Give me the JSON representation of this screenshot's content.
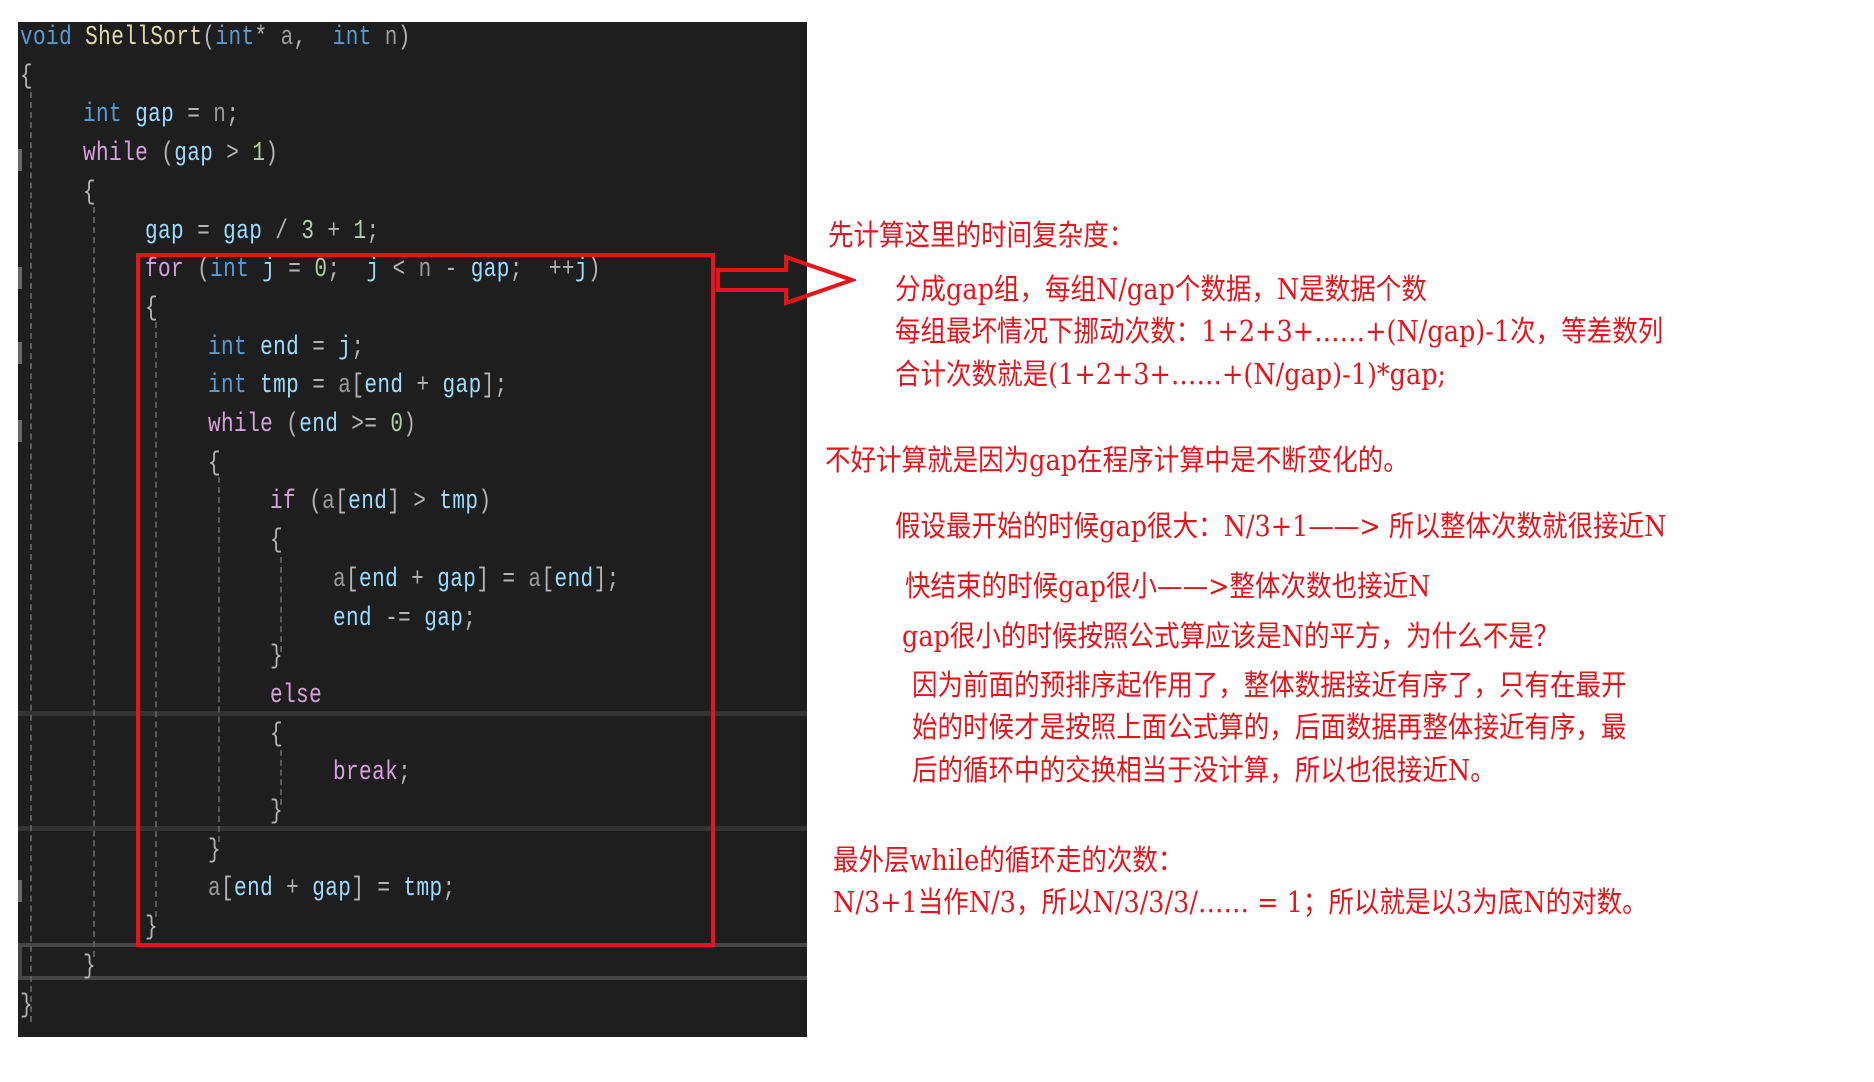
{
  "code": {
    "lines": [
      [
        {
          "t": "void",
          "c": "kw"
        },
        {
          "t": " ",
          "c": "op"
        },
        {
          "t": "ShellSort",
          "c": "fn"
        },
        {
          "t": "(",
          "c": "op"
        },
        {
          "t": "int",
          "c": "kw"
        },
        {
          "t": "* ",
          "c": "op"
        },
        {
          "t": "a",
          "c": "par"
        },
        {
          "t": ",  ",
          "c": "op"
        },
        {
          "t": "int",
          "c": "kw"
        },
        {
          "t": " ",
          "c": "op"
        },
        {
          "t": "n",
          "c": "par"
        },
        {
          "t": ")",
          "c": "op"
        }
      ],
      [
        {
          "t": "{",
          "c": "op"
        }
      ],
      [
        {
          "t": "int",
          "c": "kw"
        },
        {
          "t": " ",
          "c": "op"
        },
        {
          "t": "gap",
          "c": "var"
        },
        {
          "t": " = ",
          "c": "op"
        },
        {
          "t": "n",
          "c": "par"
        },
        {
          "t": ";",
          "c": "op"
        }
      ],
      [
        {
          "t": "while",
          "c": "ctl"
        },
        {
          "t": " (",
          "c": "op"
        },
        {
          "t": "gap",
          "c": "var"
        },
        {
          "t": " > ",
          "c": "op"
        },
        {
          "t": "1",
          "c": "num"
        },
        {
          "t": ")",
          "c": "op"
        }
      ],
      [
        {
          "t": "{",
          "c": "op"
        }
      ],
      [
        {
          "t": "gap",
          "c": "var"
        },
        {
          "t": " = ",
          "c": "op"
        },
        {
          "t": "gap",
          "c": "var"
        },
        {
          "t": " / ",
          "c": "op"
        },
        {
          "t": "3",
          "c": "num"
        },
        {
          "t": " + ",
          "c": "op"
        },
        {
          "t": "1",
          "c": "num"
        },
        {
          "t": ";",
          "c": "op"
        }
      ],
      [
        {
          "t": "for",
          "c": "ctl"
        },
        {
          "t": " (",
          "c": "op"
        },
        {
          "t": "int",
          "c": "kw"
        },
        {
          "t": " ",
          "c": "op"
        },
        {
          "t": "j",
          "c": "var"
        },
        {
          "t": " = ",
          "c": "op"
        },
        {
          "t": "0",
          "c": "num"
        },
        {
          "t": ";  ",
          "c": "op"
        },
        {
          "t": "j",
          "c": "var"
        },
        {
          "t": " < ",
          "c": "op"
        },
        {
          "t": "n",
          "c": "par"
        },
        {
          "t": " - ",
          "c": "op"
        },
        {
          "t": "gap",
          "c": "var"
        },
        {
          "t": ";  ++",
          "c": "op"
        },
        {
          "t": "j",
          "c": "var"
        },
        {
          "t": ")",
          "c": "op"
        }
      ],
      [
        {
          "t": "{",
          "c": "op"
        }
      ],
      [
        {
          "t": "int",
          "c": "kw"
        },
        {
          "t": " ",
          "c": "op"
        },
        {
          "t": "end",
          "c": "var"
        },
        {
          "t": " = ",
          "c": "op"
        },
        {
          "t": "j",
          "c": "var"
        },
        {
          "t": ";",
          "c": "op"
        }
      ],
      [
        {
          "t": "int",
          "c": "kw"
        },
        {
          "t": " ",
          "c": "op"
        },
        {
          "t": "tmp",
          "c": "var"
        },
        {
          "t": " = ",
          "c": "op"
        },
        {
          "t": "a",
          "c": "par"
        },
        {
          "t": "[",
          "c": "op"
        },
        {
          "t": "end",
          "c": "var"
        },
        {
          "t": " + ",
          "c": "op"
        },
        {
          "t": "gap",
          "c": "var"
        },
        {
          "t": "];",
          "c": "op"
        }
      ],
      [
        {
          "t": "while",
          "c": "ctl"
        },
        {
          "t": " (",
          "c": "op"
        },
        {
          "t": "end",
          "c": "var"
        },
        {
          "t": " >= ",
          "c": "op"
        },
        {
          "t": "0",
          "c": "num"
        },
        {
          "t": ")",
          "c": "op"
        }
      ],
      [
        {
          "t": "{",
          "c": "op"
        }
      ],
      [
        {
          "t": "if",
          "c": "ctl"
        },
        {
          "t": " (",
          "c": "op"
        },
        {
          "t": "a",
          "c": "par"
        },
        {
          "t": "[",
          "c": "op"
        },
        {
          "t": "end",
          "c": "var"
        },
        {
          "t": "] > ",
          "c": "op"
        },
        {
          "t": "tmp",
          "c": "var"
        },
        {
          "t": ")",
          "c": "op"
        }
      ],
      [
        {
          "t": "{",
          "c": "op"
        }
      ],
      [
        {
          "t": "a",
          "c": "par"
        },
        {
          "t": "[",
          "c": "op"
        },
        {
          "t": "end",
          "c": "var"
        },
        {
          "t": " + ",
          "c": "op"
        },
        {
          "t": "gap",
          "c": "var"
        },
        {
          "t": "] = ",
          "c": "op"
        },
        {
          "t": "a",
          "c": "par"
        },
        {
          "t": "[",
          "c": "op"
        },
        {
          "t": "end",
          "c": "var"
        },
        {
          "t": "];",
          "c": "op"
        }
      ],
      [
        {
          "t": "end",
          "c": "var"
        },
        {
          "t": " -= ",
          "c": "op"
        },
        {
          "t": "gap",
          "c": "var"
        },
        {
          "t": ";",
          "c": "op"
        }
      ],
      [
        {
          "t": "}",
          "c": "op"
        }
      ],
      [
        {
          "t": "else",
          "c": "ctl"
        }
      ],
      [
        {
          "t": "{",
          "c": "op"
        }
      ],
      [
        {
          "t": "break",
          "c": "ctl"
        },
        {
          "t": ";",
          "c": "op"
        }
      ],
      [
        {
          "t": "}",
          "c": "op"
        }
      ],
      [
        {
          "t": "}",
          "c": "op"
        }
      ],
      [
        {
          "t": "a",
          "c": "par"
        },
        {
          "t": "[",
          "c": "op"
        },
        {
          "t": "end",
          "c": "var"
        },
        {
          "t": " + ",
          "c": "op"
        },
        {
          "t": "gap",
          "c": "var"
        },
        {
          "t": "] = ",
          "c": "op"
        },
        {
          "t": "tmp",
          "c": "var"
        },
        {
          "t": ";",
          "c": "op"
        }
      ],
      [
        {
          "t": "}",
          "c": "op"
        }
      ],
      [
        {
          "t": "}",
          "c": "op"
        }
      ],
      [
        {
          "t": "}",
          "c": "op"
        }
      ]
    ],
    "indent_levels": [
      0,
      0,
      1,
      1,
      1,
      2,
      2,
      2,
      3,
      3,
      3,
      3,
      4,
      4,
      5,
      5,
      4,
      4,
      4,
      5,
      4,
      3,
      3,
      2,
      1,
      0
    ]
  },
  "annotations": {
    "heading": "先计算这里的时间复杂度：",
    "detail_1": "分成gap组，每组N/gap个数据，N是数据个数",
    "detail_2": "每组最坏情况下挪动次数：1+2+3+……+(N/gap)-1次，等差数列",
    "detail_3": "合计次数就是(1+2+3+……+(N/gap)-1)*gap;",
    "difficulty": "不好计算就是因为gap在程序计算中是不断变化的。",
    "assume_large": "假设最开始的时候gap很大：N/3+1——> 所以整体次数就很接近N",
    "near_end": "快结束的时候gap很小——>整体次数也接近N",
    "question": "gap很小的时候按照公式算应该是N的平方，为什么不是？",
    "answer_1": "因为前面的预排序起作用了，整体数据接近有序了，只有在最开",
    "answer_2": "始的时候才是按照上面公式算的，后面数据再整体接近有序，最",
    "answer_3": "后的循环中的交换相当于没计算，所以也很接近N。",
    "outer_heading": "最外层while的循环走的次数：",
    "outer_detail": "N/3+1当作N/3，所以N/3/3/3/…… = 1；所以就是以3为底N的对数。"
  },
  "colors": {
    "annotation_red": "#e8141c",
    "editor_bg": "#1e1e1e"
  }
}
